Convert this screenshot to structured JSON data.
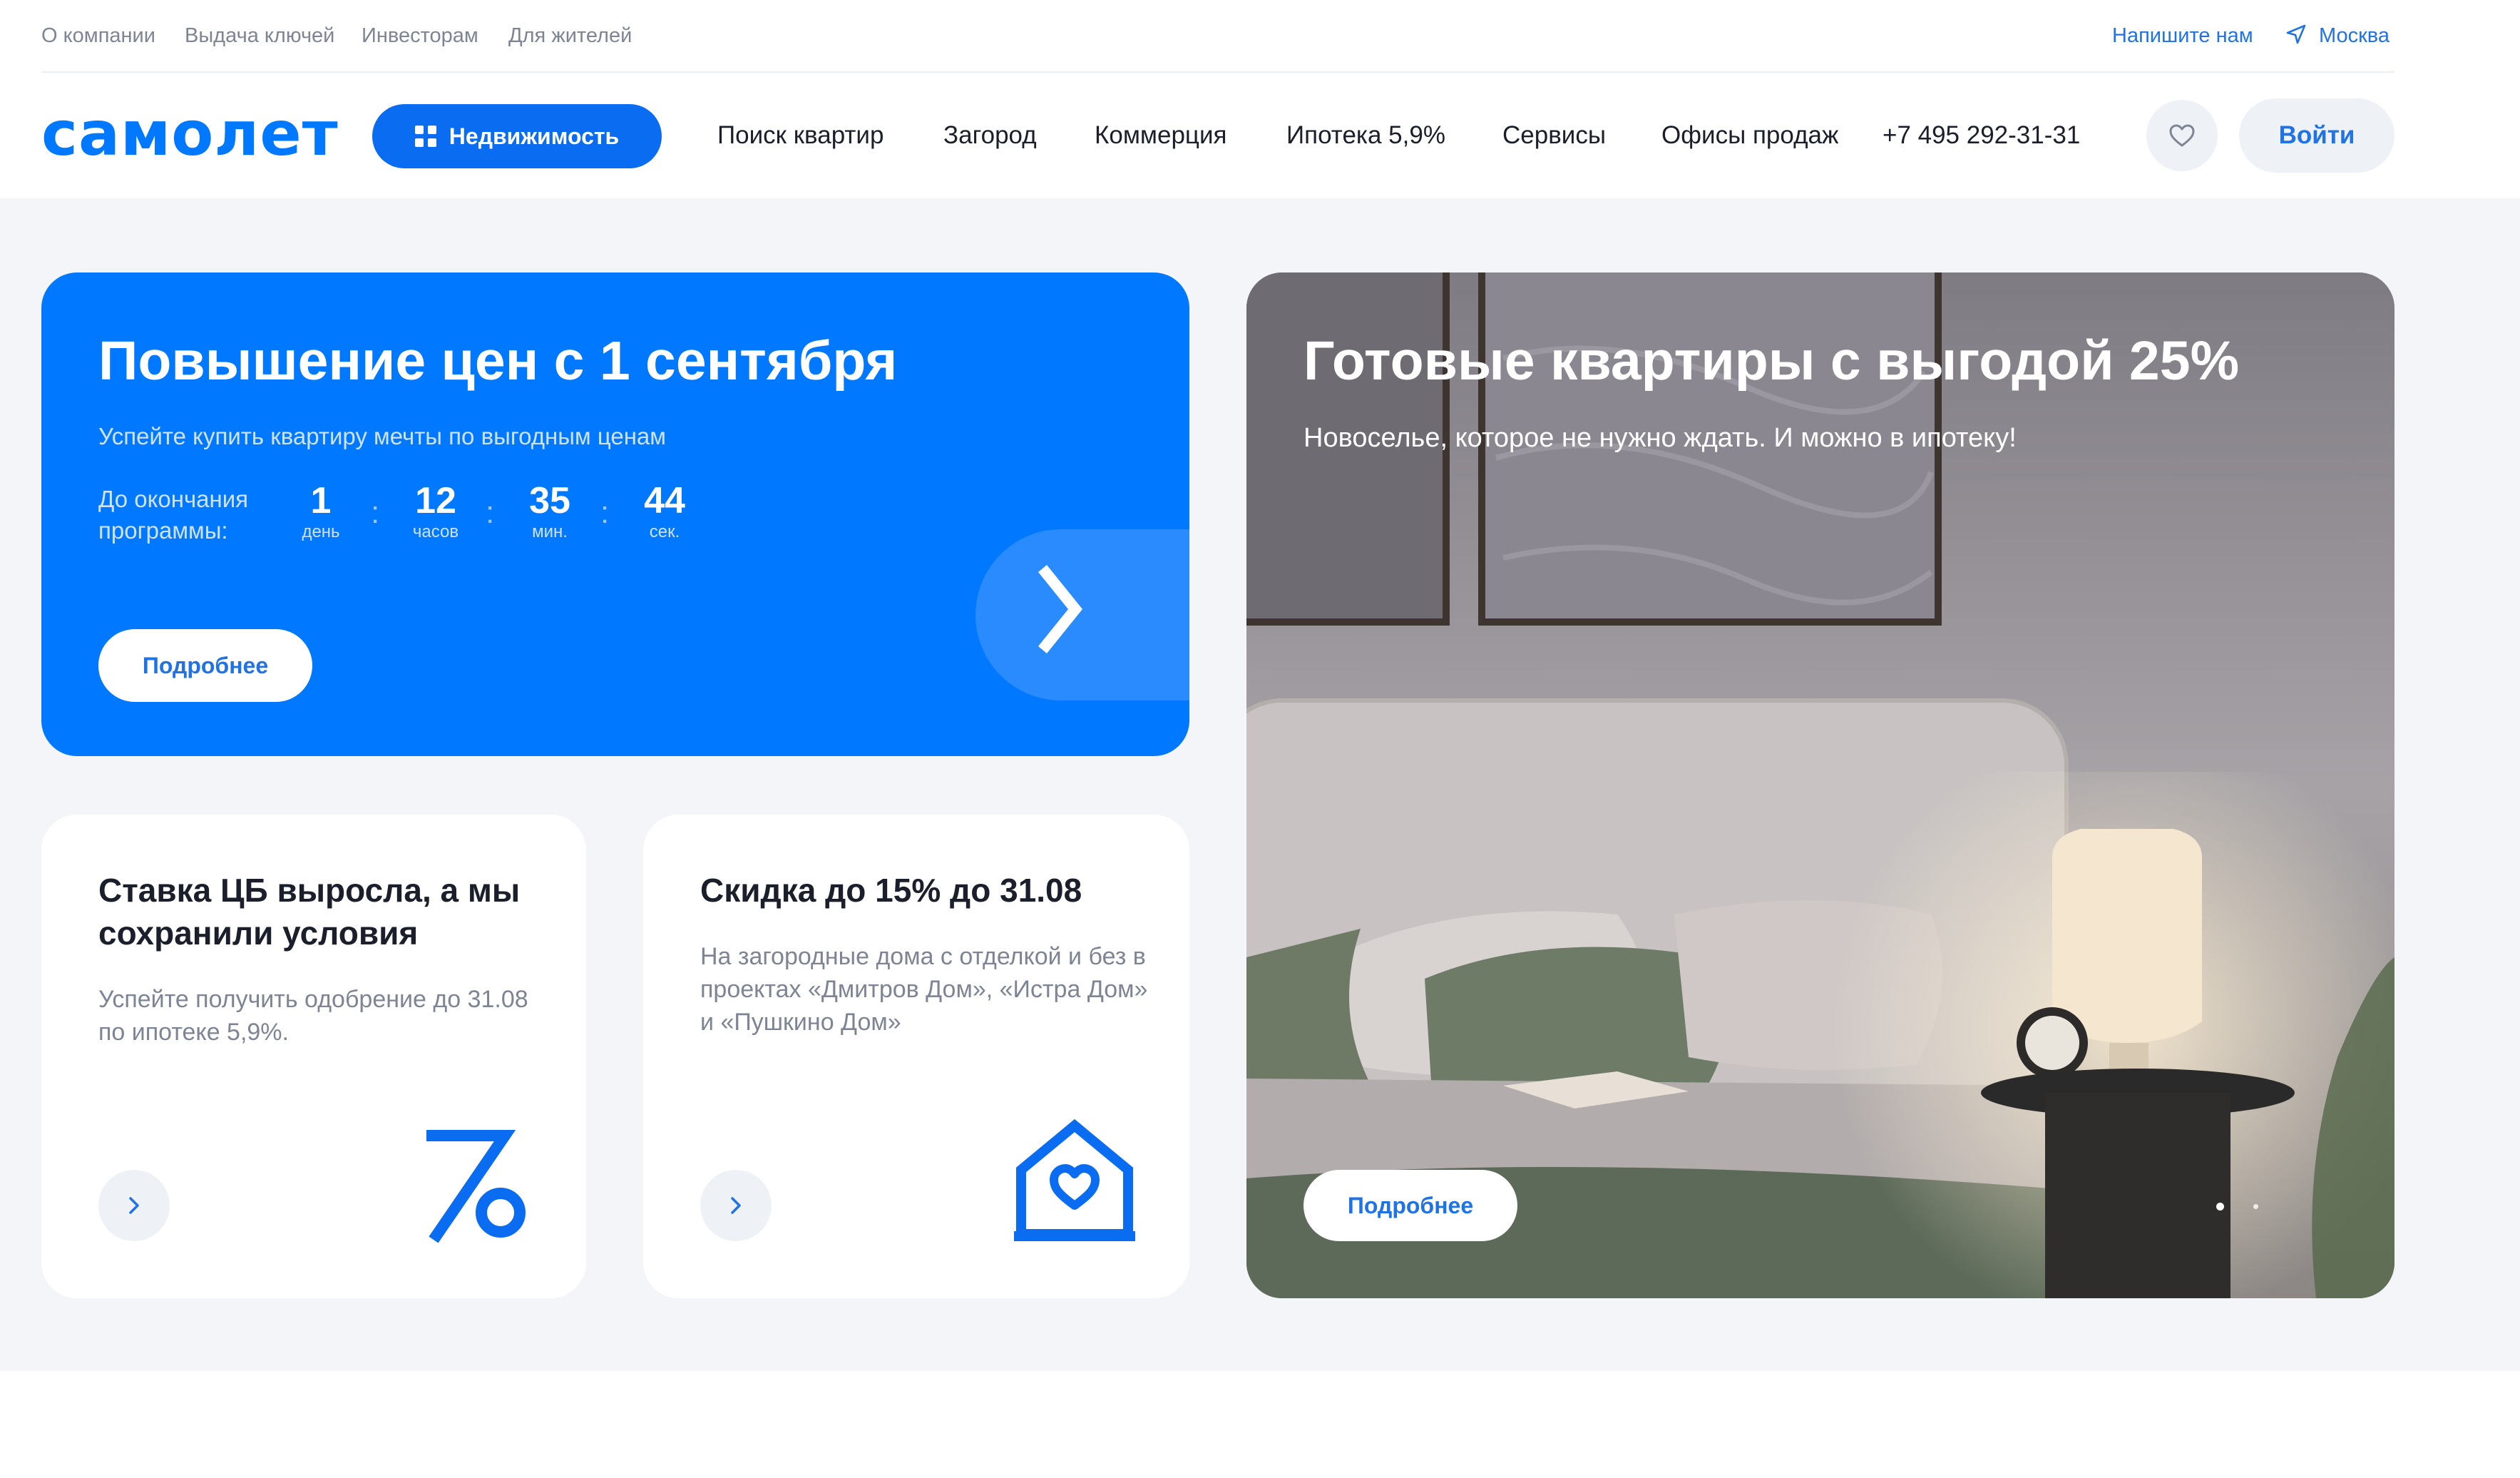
{
  "topbar": {
    "links": [
      "О компании",
      "Выдача ключей",
      "Инвесторам",
      "Для жителей"
    ],
    "contact": "Напишите нам",
    "city": "Москва"
  },
  "header": {
    "logo": "самолет",
    "realty_button": "Недвижимость",
    "nav": [
      "Поиск квартир",
      "Загород",
      "Коммерция",
      "Ипотека 5,9%",
      "Сервисы",
      "Офисы продаж"
    ],
    "phone": "+7 495 292-31-31",
    "login": "Войти"
  },
  "promo": {
    "title": "Повышение цен с 1 сентября",
    "subtitle": "Успейте купить квартиру мечты по выгодным ценам",
    "countdown_label": "До окончания программы:",
    "countdown": [
      {
        "value": "1",
        "unit": "день"
      },
      {
        "value": "12",
        "unit": "часов"
      },
      {
        "value": "35",
        "unit": "мин."
      },
      {
        "value": "44",
        "unit": "сек."
      }
    ],
    "more": "Подробнее",
    "colors": {
      "background": "#0078ff"
    }
  },
  "cards": [
    {
      "title": "Ставка ЦБ выросла, а мы сохранили условия",
      "text": "Успейте получить одобрение до 31.08 по ипотеке 5,9%.",
      "icon": "percent-icon"
    },
    {
      "title": "Скидка до 15% до 31.08",
      "text": "На загородные дома с отделкой и без в проектах «Дмитров Дом», «Истра Дом» и «Пушкино Дом»",
      "icon": "house-heart-icon"
    }
  ],
  "feature": {
    "title": "Готовые квартиры с выгодой 25%",
    "subtitle": "Новоселье, которое не нужно ждать. И можно в ипотеку!",
    "more": "Подробнее",
    "slides_total": 2,
    "slide_active": 1
  },
  "colors": {
    "accent": "#0078ff",
    "link": "#1f73e6",
    "page_bg": "#f3f5f9"
  }
}
